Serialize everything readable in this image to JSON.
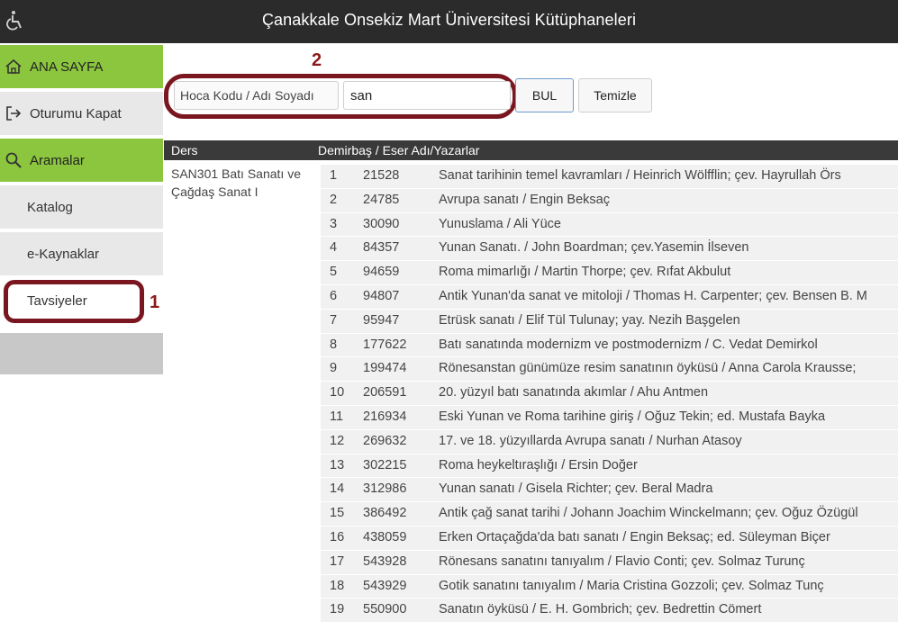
{
  "header": {
    "title": "Çanakkale Onsekiz Mart Üniversitesi Kütüphaneleri"
  },
  "sidebar": {
    "items": [
      {
        "label": "ANA SAYFA",
        "icon": "home-icon"
      },
      {
        "label": "Oturumu Kapat",
        "icon": "logout-icon"
      },
      {
        "label": "Aramalar",
        "icon": "search-icon"
      },
      {
        "label": "Katalog"
      },
      {
        "label": "e-Kaynaklar"
      },
      {
        "label": "Tavsiyeler"
      }
    ]
  },
  "annotations": {
    "one": "1",
    "two": "2",
    "color": "#7a1620"
  },
  "search": {
    "label": "Hoca Kodu / Adı Soyadı",
    "value": "san",
    "search_button": "BUL",
    "clear_button": "Temizle"
  },
  "table": {
    "headers": {
      "ders": "Ders",
      "eser": "Demirbaş / Eser Adı/Yazarlar"
    },
    "course": "SAN301 Batı Sanatı ve Çağdaş Sanat I",
    "rows": [
      {
        "no": "1",
        "demirbas": "21528",
        "eser": "Sanat tarihinin temel kavramları / Heinrich Wölfflin; çev. Hayrullah Örs"
      },
      {
        "no": "2",
        "demirbas": "24785",
        "eser": "Avrupa sanatı / Engin Beksaç"
      },
      {
        "no": "3",
        "demirbas": "30090",
        "eser": "Yunuslama / Ali Yüce"
      },
      {
        "no": "4",
        "demirbas": "84357",
        "eser": "Yunan Sanatı. / John Boardman; çev.Yasemin İlseven"
      },
      {
        "no": "5",
        "demirbas": "94659",
        "eser": "Roma mimarlığı / Martin Thorpe; çev. Rıfat Akbulut"
      },
      {
        "no": "6",
        "demirbas": "94807",
        "eser": "Antik Yunan'da sanat ve mitoloji / Thomas H. Carpenter; çev. Bensen B. M"
      },
      {
        "no": "7",
        "demirbas": "95947",
        "eser": "Etrüsk sanatı / Elif Tül Tulunay; yay. Nezih Başgelen"
      },
      {
        "no": "8",
        "demirbas": "177622",
        "eser": "Batı sanatında modernizm ve postmodernizm / C. Vedat Demirkol"
      },
      {
        "no": "9",
        "demirbas": "199474",
        "eser": "Rönesanstan günümüze resim sanatının öyküsü / Anna Carola Krausse;"
      },
      {
        "no": "10",
        "demirbas": "206591",
        "eser": "20. yüzyıl batı sanatında akımlar / Ahu Antmen"
      },
      {
        "no": "11",
        "demirbas": "216934",
        "eser": "Eski Yunan ve Roma tarihine giriş / Oğuz Tekin; ed. Mustafa Bayka"
      },
      {
        "no": "12",
        "demirbas": "269632",
        "eser": "17. ve 18. yüzyıllarda Avrupa sanatı / Nurhan Atasoy"
      },
      {
        "no": "13",
        "demirbas": "302215",
        "eser": "Roma heykeltıraşlığı / Ersin Doğer"
      },
      {
        "no": "14",
        "demirbas": "312986",
        "eser": "Yunan sanatı / Gisela Richter; çev. Beral Madra"
      },
      {
        "no": "15",
        "demirbas": "386492",
        "eser": "Antik çağ sanat tarihi / Johann Joachim Winckelmann; çev. Oğuz Özügül"
      },
      {
        "no": "16",
        "demirbas": "438059",
        "eser": "Erken Ortaçağda'da batı sanatı / Engin Beksaç; ed. Süleyman Biçer"
      },
      {
        "no": "17",
        "demirbas": "543928",
        "eser": "Rönesans sanatını tanıyalım / Flavio Conti; çev. Solmaz Turunç"
      },
      {
        "no": "18",
        "demirbas": "543929",
        "eser": "Gotik sanatını tanıyalım / Maria Cristina Gozzoli; çev. Solmaz Tunç"
      },
      {
        "no": "19",
        "demirbas": "550900",
        "eser": "Sanatın öyküsü / E. H. Gombrich; çev. Bedrettin Cömert"
      }
    ]
  }
}
